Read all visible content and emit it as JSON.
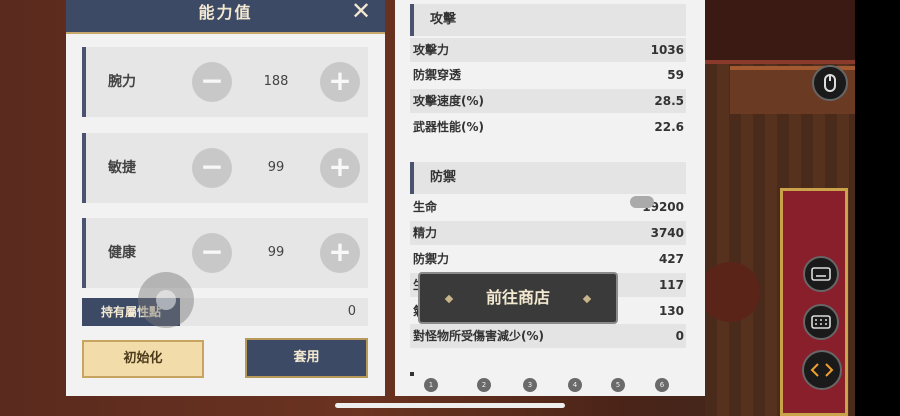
{
  "stat_panel": {
    "title": "能力值",
    "close_symbol": "✕",
    "stats": [
      {
        "label": "腕力",
        "value": "188"
      },
      {
        "label": "敏捷",
        "value": "99"
      },
      {
        "label": "健康",
        "value": "99"
      }
    ],
    "minus_symbol": "−",
    "plus_symbol": "+",
    "points_label": "持有屬性點",
    "points_value": "0",
    "reset_label": "初始化",
    "apply_label": "套用"
  },
  "info_panel": {
    "attack_title": "攻擊",
    "attack_rows": [
      {
        "label": "攻擊力",
        "value": "1036"
      },
      {
        "label": "防禦穿透",
        "value": "59"
      },
      {
        "label": "攻擊速度(%)",
        "value": "28.5"
      },
      {
        "label": "武器性能(%)",
        "value": "22.6"
      }
    ],
    "defense_title": "防禦",
    "defense_rows": [
      {
        "label": "生命",
        "value": "19200"
      },
      {
        "label": "精力",
        "value": "3740"
      },
      {
        "label": "防禦力",
        "value": "427"
      },
      {
        "label": "生",
        "value": "117"
      },
      {
        "label": "氣",
        "value": "130"
      },
      {
        "label": "對怪物所受傷害減少(%)",
        "value": "0"
      }
    ],
    "shop_button": "前往商店",
    "pages": [
      "1",
      "2",
      "3",
      "4",
      "5",
      "6"
    ]
  },
  "overlay": {
    "mouse_icon": "mouse-icon",
    "keyboard_icon": "keyboard-icon",
    "keypad_icon": "keypad-icon",
    "arrows_icon": "arrows-icon"
  },
  "colors": {
    "panel_header": "#3c4a66",
    "accent_gold": "#c8a86a",
    "reset_bg": "#f1dcaa"
  }
}
